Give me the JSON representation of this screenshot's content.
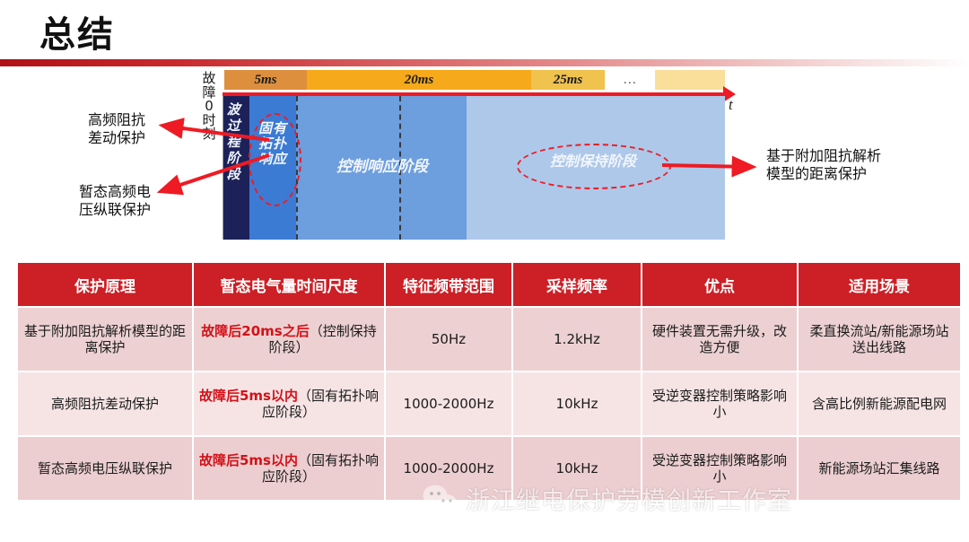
{
  "slide": {
    "title": "总结"
  },
  "diagram": {
    "axis_label": "t",
    "origin_label": [
      "故",
      "障",
      "0",
      "时",
      "刻"
    ],
    "time_marks": [
      {
        "label": "5ms",
        "color": "#dd8f3e"
      },
      {
        "label": "20ms",
        "color": "#f5a91b"
      },
      {
        "label": "25ms",
        "color": "#f0c24e"
      },
      {
        "label": "…",
        "color": "#ffffff"
      },
      {
        "label": "",
        "color": "#fadf9a"
      }
    ],
    "phases": [
      {
        "name": "波过程阶段",
        "color": "#1c2259"
      },
      {
        "name": "固有拓扑响应",
        "color": "#3c7bd4"
      },
      {
        "name": "控制响应阶段",
        "color": "#6d9ede"
      },
      {
        "name": "控制保持阶段",
        "color": "#aec8ea"
      }
    ],
    "callouts": {
      "left_top": [
        "高频阻抗",
        "差动保护"
      ],
      "left_bottom": [
        "暂态高频电",
        "压纵联保护"
      ],
      "right": [
        "基于附加阻抗解析",
        "模型的距离保护"
      ]
    }
  },
  "table": {
    "headers": [
      "保护原理",
      "暂态电气量时间尺度",
      "特征频带范围",
      "采样频率",
      "优点",
      "适用场景"
    ],
    "rows": [
      {
        "principle": "基于附加阻抗解析模型的距离保护",
        "timescale_hl": "故障后20ms之后",
        "timescale_rest": "（控制保持阶段）",
        "band": "50Hz",
        "sampling": "1.2kHz",
        "advantage": "硬件装置无需升级，改造方便",
        "scenario": "柔直换流站/新能源场站送出线路"
      },
      {
        "principle": "高频阻抗差动保护",
        "timescale_hl": "故障后5ms以内",
        "timescale_rest": "（固有拓扑响应阶段）",
        "band": "1000-2000Hz",
        "sampling": "10kHz",
        "advantage": "受逆变器控制策略影响小",
        "scenario": "含高比例新能源配电网"
      },
      {
        "principle": "暂态高频电压纵联保护",
        "timescale_hl": "故障后5ms以内",
        "timescale_rest": "（固有拓扑响应阶段）",
        "band": "1000-2000Hz",
        "sampling": "10kHz",
        "advantage": "受逆变器控制策略影响小",
        "scenario": "新能源场站汇集线路"
      }
    ]
  },
  "watermark": {
    "text": "浙江继电保护劳模创新工作室"
  },
  "colors": {
    "brand_red": "#cc2026",
    "highlight_red": "#d41118",
    "axis_red": "#ee1b24"
  }
}
